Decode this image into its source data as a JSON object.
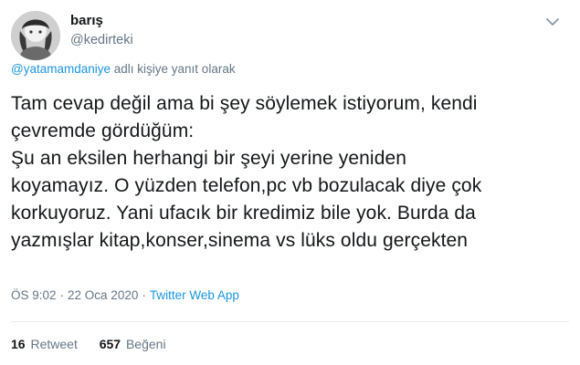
{
  "author": {
    "name": "barış",
    "handle": "@kedirteki"
  },
  "reply_context": {
    "mention": "@yatamamdaniye",
    "suffix": " adlı kişiye yanıt olarak"
  },
  "tweet": {
    "lines": [
      "Tam cevap değil ama bi şey söylemek istiyorum, kendi",
      "çevremde gördüğüm:",
      "Şu an eksilen herhangi bir şeyi yerine yeniden",
      "koyamayız. O yüzden telefon,pc vb bozulacak diye çok",
      "korkuyoruz. Yani ufacık bir kredimiz bile yok. Burda da",
      "yazmışlar kitap,konser,sinema vs lüks oldu gerçekten"
    ]
  },
  "meta": {
    "time": "ÖS 9:02",
    "date": "22 Oca 2020",
    "separator": "·",
    "source": "Twitter Web App"
  },
  "stats": {
    "retweets_count": "16",
    "retweets_label": "Retweet",
    "likes_count": "657",
    "likes_label": "Beğeni"
  },
  "icons": {
    "more": "chevron-down-icon"
  },
  "colors": {
    "link": "#1b95e0",
    "secondary": "#657786",
    "text": "#14171a",
    "divider": "#e6ecf0"
  }
}
